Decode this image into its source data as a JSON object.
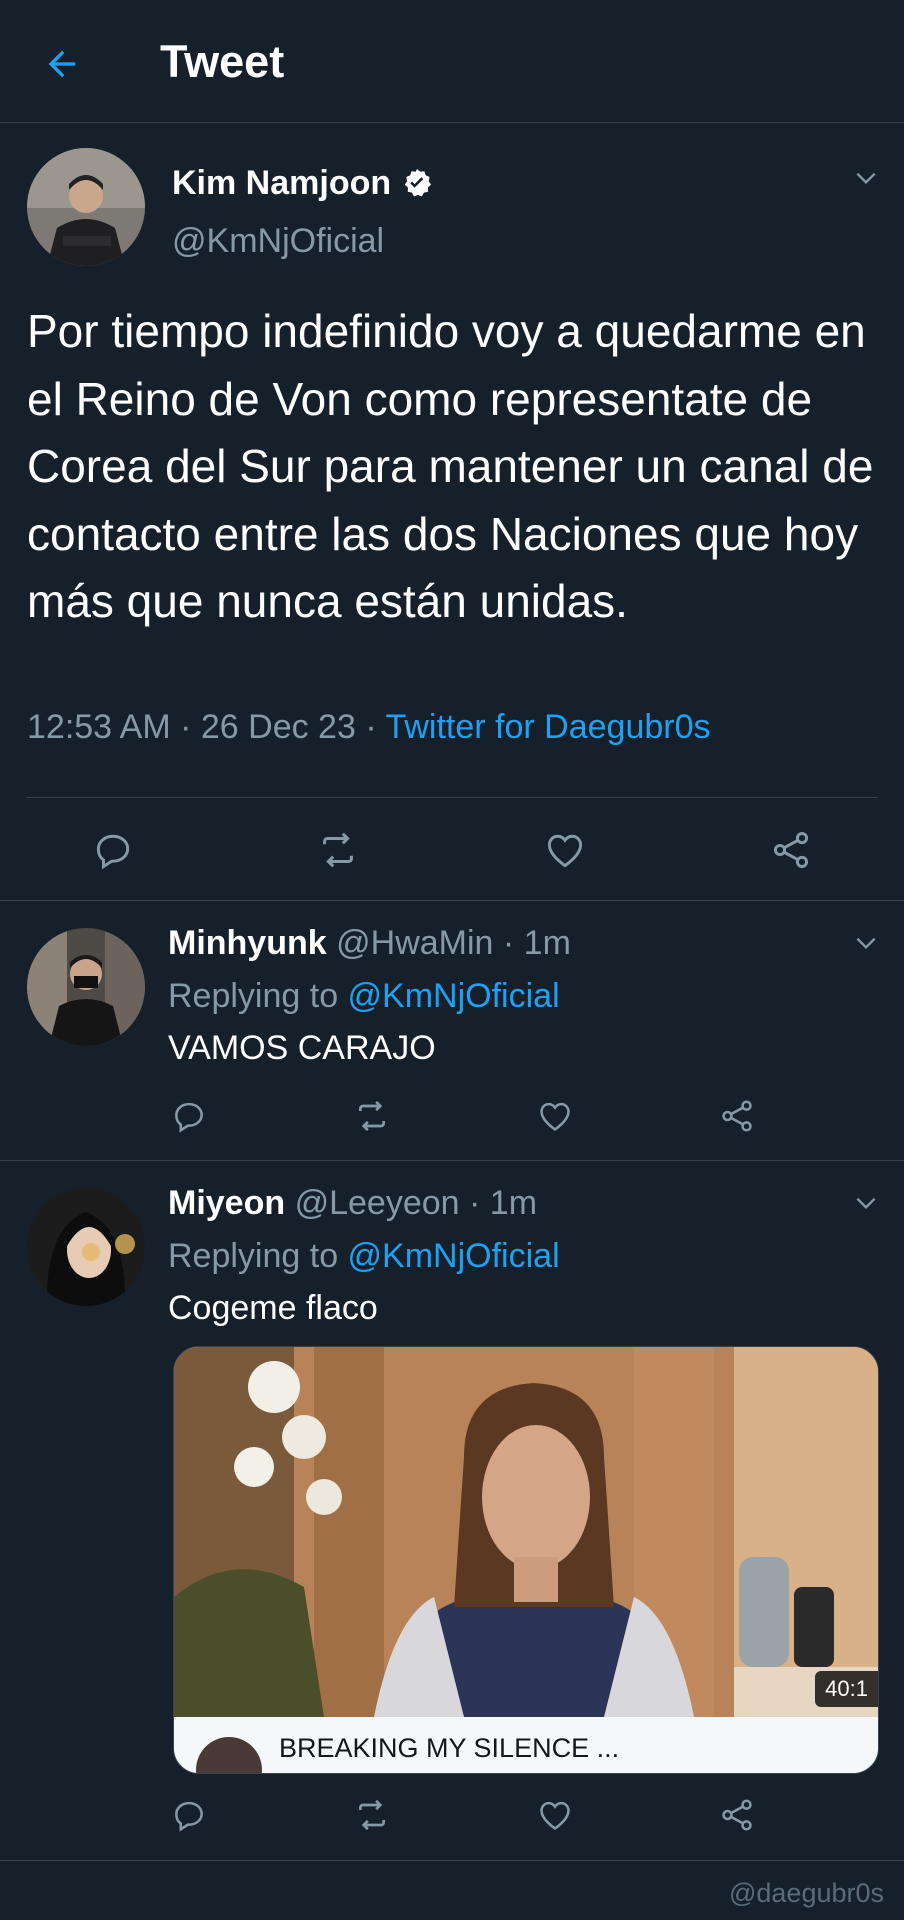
{
  "header": {
    "title": "Tweet",
    "back_icon": "arrow-left-icon"
  },
  "main_tweet": {
    "author_name": "Kim Namjoon",
    "author_handle": "@KmNjOficial",
    "verified": true,
    "text": "Por tiempo indefinido voy a quedarme en el Reino de Von como representate de Corea del Sur para mantener un canal de contacto entre las dos Naciones que hoy más que nunca están unidas.",
    "time": "12:53 AM",
    "date": "26 Dec 23",
    "separator": " · ",
    "source": "Twitter for Daegubr0s"
  },
  "replies": [
    {
      "name": "Minhyunk",
      "handle": "@HwaMin",
      "time": "· 1m",
      "replying_label": "Replying to ",
      "replying_to": "@KmNjOficial",
      "text": "VAMOS CARAJO"
    },
    {
      "name": "Miyeon",
      "handle": "@Leeyeon",
      "time": "· 1m",
      "replying_label": "Replying to ",
      "replying_to": "@KmNjOficial",
      "text": "Cogeme flaco",
      "media": {
        "duration": "40:1",
        "title": "BREAKING MY SILENCE ..."
      }
    }
  ],
  "watermark": "@daegubr0s",
  "colors": {
    "background": "#15202b",
    "accent": "#1da1f2",
    "muted": "#8899a6",
    "divider": "#38444d"
  }
}
